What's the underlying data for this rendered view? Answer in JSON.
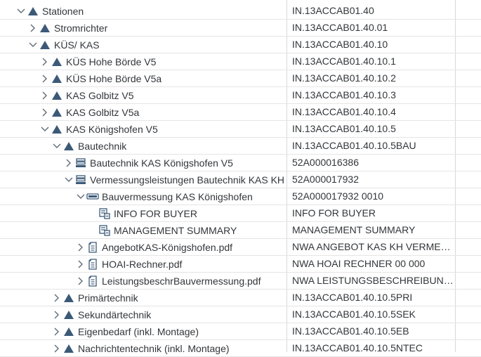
{
  "tree": {
    "rows": [
      {
        "level": 0,
        "expand": "open",
        "icon": "triangle-icon",
        "label": "Stationen",
        "code": "IN.13ACCAB01.40"
      },
      {
        "level": 1,
        "expand": "closed",
        "icon": "triangle-icon",
        "label": "Stromrichter",
        "code": "IN.13ACCAB01.40.01"
      },
      {
        "level": 1,
        "expand": "open",
        "icon": "triangle-icon",
        "label": "KÜS/ KAS",
        "code": "IN.13ACCAB01.40.10"
      },
      {
        "level": 2,
        "expand": "closed",
        "icon": "triangle-icon",
        "label": "KÜS Hohe Börde V5",
        "code": "IN.13ACCAB01.40.10.1"
      },
      {
        "level": 2,
        "expand": "closed",
        "icon": "triangle-icon",
        "label": "KÜS Hohe Börde V5a",
        "code": "IN.13ACCAB01.40.10.2"
      },
      {
        "level": 2,
        "expand": "closed",
        "icon": "triangle-icon",
        "label": "KAS Golbitz V5",
        "code": "IN.13ACCAB01.40.10.3"
      },
      {
        "level": 2,
        "expand": "closed",
        "icon": "triangle-icon",
        "label": "KAS Golbitz V5a",
        "code": "IN.13ACCAB01.40.10.4"
      },
      {
        "level": 2,
        "expand": "open",
        "icon": "triangle-icon",
        "label": "KAS Königshofen V5",
        "code": "IN.13ACCAB01.40.10.5"
      },
      {
        "level": 3,
        "expand": "open",
        "icon": "triangle-icon",
        "label": "Bautechnik",
        "code": "IN.13ACCAB01.40.10.5BAU"
      },
      {
        "level": 4,
        "expand": "closed",
        "icon": "order-icon",
        "label": "Bautechnik KAS Königshofen V5",
        "code": "52A000016386"
      },
      {
        "level": 4,
        "expand": "open",
        "icon": "order-icon",
        "label": "Vermessungsleistungen Bautechnik KAS KH",
        "code": "52A000017932"
      },
      {
        "level": 5,
        "expand": "open",
        "icon": "item-icon",
        "label": "Bauvermessung KAS Königshofen",
        "code": "52A000017932 0010"
      },
      {
        "level": 6,
        "expand": "none",
        "icon": "note-icon",
        "label": "INFO FOR BUYER",
        "code": "INFO FOR BUYER"
      },
      {
        "level": 6,
        "expand": "none",
        "icon": "note-icon",
        "label": "MANAGEMENT SUMMARY",
        "code": "MANAGEMENT SUMMARY"
      },
      {
        "level": 5,
        "expand": "closed",
        "icon": "document-icon",
        "label": "AngebotKAS-Königshofen.pdf",
        "code": "NWA ANGEBOT KAS KH VERMESSUNG"
      },
      {
        "level": 5,
        "expand": "closed",
        "icon": "document-icon",
        "label": "HOAI-Rechner.pdf",
        "code": "NWA HOAI RECHNER 00 000"
      },
      {
        "level": 5,
        "expand": "closed",
        "icon": "document-icon",
        "label": "LeistungsbeschrBauvermessung.pdf",
        "code": "NWA LEISTUNGSBESCHREIBUNG BAUVERMESSUNG"
      },
      {
        "level": 3,
        "expand": "closed",
        "icon": "triangle-icon",
        "label": "Primärtechnik",
        "code": "IN.13ACCAB01.40.10.5PRI"
      },
      {
        "level": 3,
        "expand": "closed",
        "icon": "triangle-icon",
        "label": "Sekundärtechnik",
        "code": "IN.13ACCAB01.40.10.5SEK"
      },
      {
        "level": 3,
        "expand": "closed",
        "icon": "triangle-icon",
        "label": "Eigenbedarf (inkl. Montage)",
        "code": "IN.13ACCAB01.40.10.5EB"
      },
      {
        "level": 3,
        "expand": "closed",
        "icon": "triangle-icon",
        "label": "Nachrichtentechnik (inkl. Montage)",
        "code": "IN.13ACCAB01.40.10.5NTEC"
      }
    ]
  },
  "colors": {
    "icon": "#3c5a78",
    "chevron": "#5f6b76",
    "border": "#e5e5e5",
    "text": "#32363a"
  }
}
